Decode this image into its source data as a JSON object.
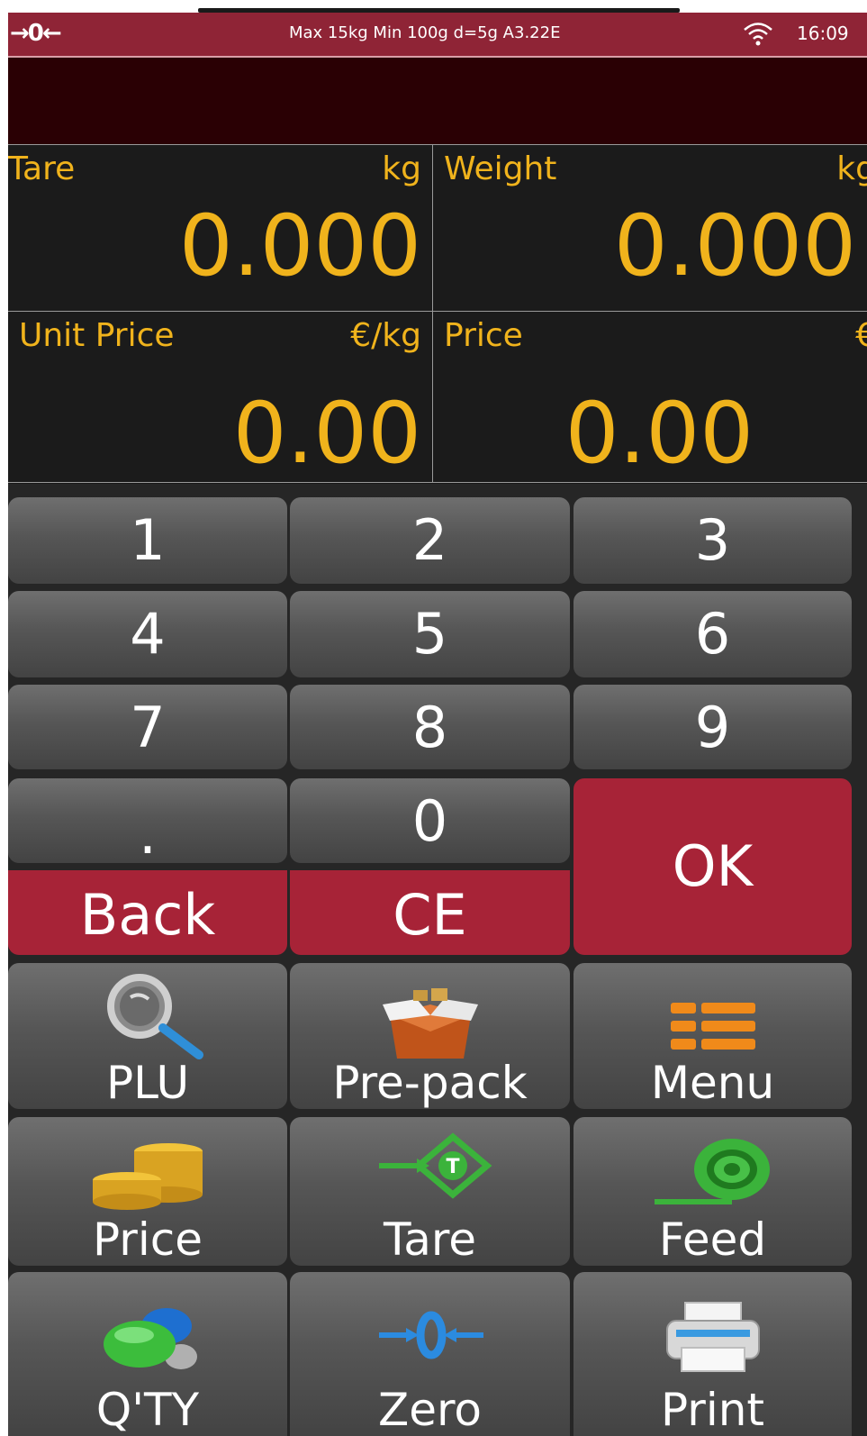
{
  "status": {
    "zero_indicator": "→0←",
    "spec": "Max 15kg Min 100g d=5g  A3.22E",
    "time": "16:09"
  },
  "readouts": {
    "tare": {
      "label": "Tare",
      "unit": "kg",
      "value": "0.000"
    },
    "weight": {
      "label": "Weight",
      "unit": "kg",
      "value": "0.000"
    },
    "unit_price": {
      "label": "Unit Price",
      "unit": "€/kg",
      "value": "0.00"
    },
    "price": {
      "label": "Price",
      "unit": "€",
      "value": "0.00"
    }
  },
  "keypad": {
    "k1": "1",
    "k2": "2",
    "k3": "3",
    "k4": "4",
    "k5": "5",
    "k6": "6",
    "k7": "7",
    "k8": "8",
    "k9": "9",
    "dot": ".",
    "k0": "0",
    "ok": "OK",
    "back": "Back",
    "ce": "CE"
  },
  "functions": {
    "plu": {
      "label": "PLU",
      "icon": "magnifier-icon"
    },
    "prepack": {
      "label": "Pre-pack",
      "icon": "box-icon"
    },
    "menu": {
      "label": "Menu",
      "icon": "menu-list-icon"
    },
    "price": {
      "label": "Price",
      "icon": "coins-icon"
    },
    "tare": {
      "label": "Tare",
      "icon": "tare-arrow-icon"
    },
    "feed": {
      "label": "Feed",
      "icon": "paper-roll-icon"
    },
    "qty": {
      "label": "Q'TY",
      "icon": "bubbles-icon"
    },
    "zero": {
      "label": "Zero",
      "icon": "zero-arrows-icon"
    },
    "print": {
      "label": "Print",
      "icon": "printer-icon"
    }
  },
  "colors": {
    "accent_red": "#a72337",
    "status_bar": "#8f2436",
    "readout_text": "#f0b31c"
  }
}
